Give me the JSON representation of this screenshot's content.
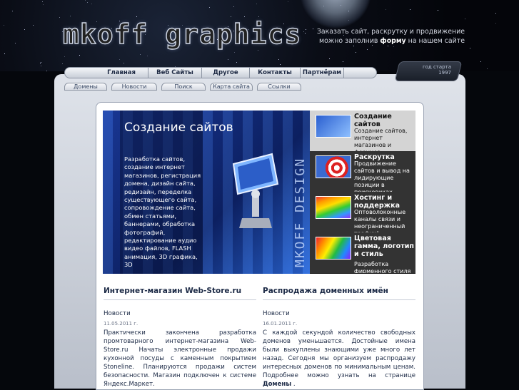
{
  "header": {
    "logo": "mkoff graphics",
    "tagline_line1": "Заказать сайт, раскрутку и продвижение",
    "tagline_line2_pre": "можно заполнив",
    "tagline_link": "форму",
    "tagline_line2_post": "на нашем сайте",
    "badge": "год старта 1997"
  },
  "main_nav": [
    "Главная",
    "Веб Сайты",
    "Другое",
    "Контакты",
    "Партнёрам"
  ],
  "sub_nav": [
    "Домены",
    "Новости",
    "Поиск",
    "Карта сайта",
    "Ссылки"
  ],
  "banner": {
    "title": "Создание сайтов",
    "description": "Разработка сайтов, создание интернет магазинов, регистрация домена, дизайн сайта, редизайн, переделка существующего сайта, сопровождение сайта, обмен статьями, баннерами, обработка фотографий, редактирование аудио видео файлов, FLASH анимация, 3D графика, 3D",
    "vertical_brand": "MKOFF DESIGN"
  },
  "side_items": [
    {
      "title": "Создание сайтов",
      "desc": "Создание сайтов, интернет магазинов и форумов",
      "bg": "#d4d4d4",
      "fg": "#111111"
    },
    {
      "title": "Раскрутка",
      "desc": "Продвижение сайтов и вывод на лидирующие позиции в поисковиках",
      "bg": "#333333",
      "fg": "#ffffff"
    },
    {
      "title": "Хостинг и поддержка",
      "desc": "Оптоволоконные каналы связи и неограниченный трафик!",
      "bg": "#333333",
      "fg": "#ffffff"
    },
    {
      "title": "Цветовая гамма, логотип и стиль",
      "desc": "Разработка фирменного стиля",
      "bg": "#333333",
      "fg": "#ffffff"
    }
  ],
  "columns": [
    {
      "heading": "Интернет-магазин Web-Store.ru",
      "sub": "Новости",
      "date": "11.05.2011 г.",
      "text": "Практически закончена разработка промтоварного интернет-магазина Web-Store.ru Начаты электронные продажи кухонной посуды с каменным покрытием Stoneline. Планируются продажи систем безопасности. Магазин подключен к системе Яндекс.Маркет."
    },
    {
      "heading": "Распродажа доменных имён",
      "sub": "Новости",
      "date": "16.01.2011 г.",
      "text": "С каждой секундой количество свободных доменов уменьшается. Достойные имена были выкуплены знающими уже много лет назад. Сегодня мы организуем распродажу интересных доменов по минимальным ценам. Подробнее можно узнать на странице",
      "link": "Домены",
      "text_end": "."
    }
  ]
}
